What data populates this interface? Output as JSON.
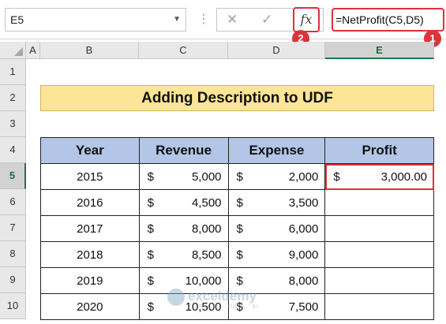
{
  "formula_bar": {
    "name_box": "E5",
    "more_dots": "⋮",
    "cancel_icon": "✕",
    "enter_icon": "✓",
    "fx_label": "fx",
    "formula": "=NetProfit(C5,D5)",
    "callout_fx": "2",
    "callout_formula": "1"
  },
  "accent_color": "#e0303a",
  "columns": [
    "A",
    "B",
    "C",
    "D",
    "E"
  ],
  "selected_column": "E",
  "rows": [
    "1",
    "2",
    "3",
    "4",
    "5",
    "6",
    "7",
    "8",
    "9",
    "10"
  ],
  "selected_row": "5",
  "title": "Adding Description to UDF",
  "table": {
    "headers": [
      "Year",
      "Revenue",
      "Expense",
      "Profit"
    ],
    "rows": [
      {
        "year": "2015",
        "rev_cur": "$",
        "revenue": "5,000",
        "exp_cur": "$",
        "expense": "2,000",
        "profit_cur": "$",
        "profit": "3,000.00"
      },
      {
        "year": "2016",
        "rev_cur": "$",
        "revenue": "4,500",
        "exp_cur": "$",
        "expense": "3,500",
        "profit_cur": "",
        "profit": ""
      },
      {
        "year": "2017",
        "rev_cur": "$",
        "revenue": "8,000",
        "exp_cur": "$",
        "expense": "6,000",
        "profit_cur": "",
        "profit": ""
      },
      {
        "year": "2018",
        "rev_cur": "$",
        "revenue": "8,500",
        "exp_cur": "$",
        "expense": "9,000",
        "profit_cur": "",
        "profit": ""
      },
      {
        "year": "2019",
        "rev_cur": "$",
        "revenue": "10,000",
        "exp_cur": "$",
        "expense": "8,000",
        "profit_cur": "",
        "profit": ""
      },
      {
        "year": "2020",
        "rev_cur": "$",
        "revenue": "10,500",
        "exp_cur": "$",
        "expense": "7,500",
        "profit_cur": "",
        "profit": ""
      }
    ]
  },
  "watermark": {
    "name": "exceldemy",
    "tagline": "EXCEL · DATA · BI"
  }
}
